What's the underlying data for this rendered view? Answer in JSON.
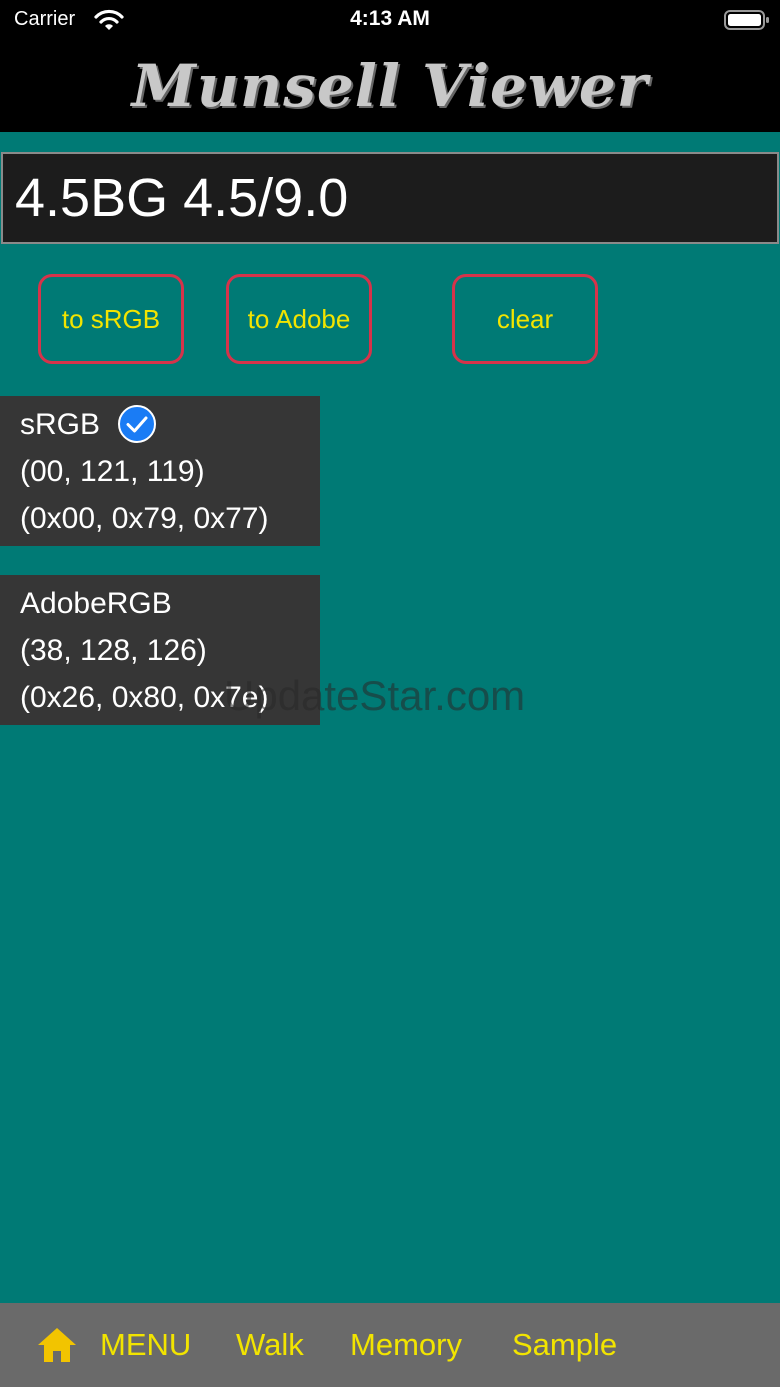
{
  "status_bar": {
    "carrier": "Carrier",
    "time": "4:13 AM",
    "wifi_icon": "wifi-icon",
    "battery_icon": "battery-icon"
  },
  "header": {
    "title": "Munsell Viewer"
  },
  "munsell_input": {
    "value": "4.5BG 4.5/9.0"
  },
  "buttons": {
    "to_srgb": "to sRGB",
    "to_adobe": "to Adobe",
    "clear": "clear"
  },
  "results": {
    "srgb": {
      "label": "sRGB",
      "selected": true,
      "decimal": "(00, 121, 119)",
      "hex": "(0x00, 0x79, 0x77)"
    },
    "adobergb": {
      "label": "AdobeRGB",
      "decimal": "(38, 128, 126)",
      "hex": "(0x26, 0x80, 0x7e)"
    }
  },
  "watermark": "UpdateStar.com",
  "tabbar": {
    "home_icon": "home-icon",
    "items": [
      "MENU",
      "Walk",
      "Memory",
      "Sample"
    ]
  },
  "colors": {
    "background": "#007a75",
    "button_border": "#d6334a",
    "accent_text": "#f2e400",
    "panel": "#363636",
    "check": "#1a7cf5"
  }
}
